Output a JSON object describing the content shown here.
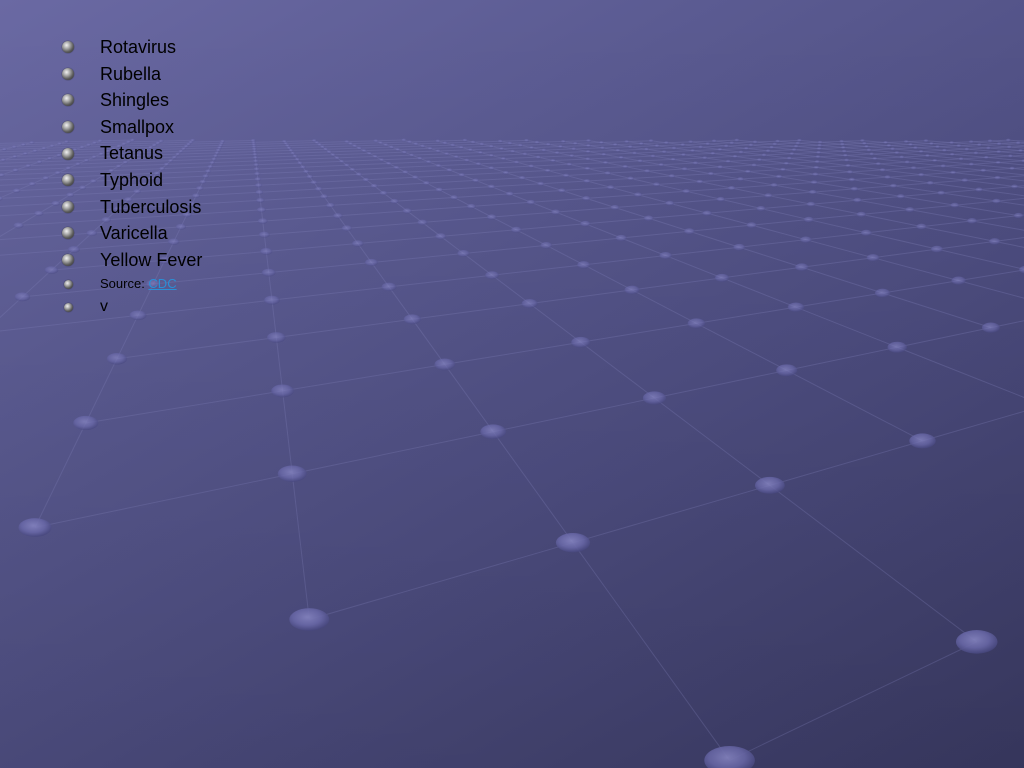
{
  "slide": {
    "items": [
      "Rotavirus",
      "Rubella",
      "Shingles",
      "Smallpox",
      "Tetanus",
      "Typhoid",
      "Tuberculosis",
      "Varicella",
      "Yellow Fever"
    ],
    "source_label": "Source: ",
    "source_link": "CDC",
    "last_item": "v"
  },
  "colors": {
    "background_top": "#6a69a3",
    "background_bottom": "#3a3a63",
    "link": "#2b8fd6",
    "bullet": "#9a9a9a"
  },
  "icons": {
    "bullet": "sphere-bullet-icon",
    "background": "dotted-grid-pattern"
  }
}
